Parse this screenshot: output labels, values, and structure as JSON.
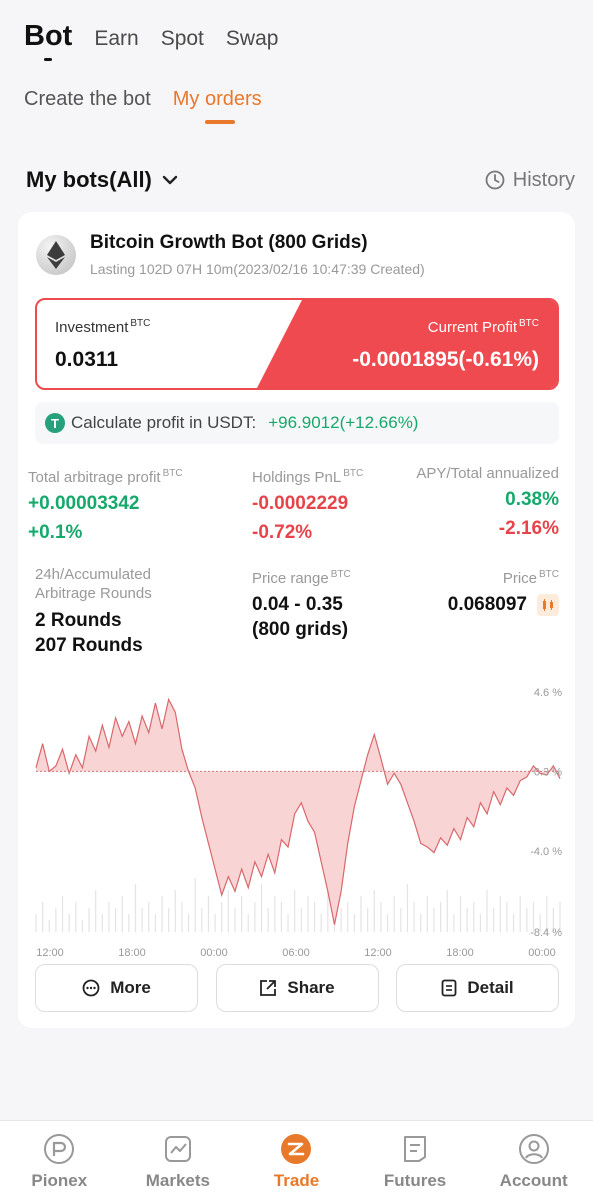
{
  "top_tabs": [
    "Bot",
    "Earn",
    "Spot",
    "Swap"
  ],
  "sub_tabs": [
    "Create the bot",
    "My orders"
  ],
  "bots_header": {
    "title": "My bots(All)",
    "history": "History"
  },
  "bot": {
    "name": "Bitcoin Growth Bot (800 Grids)",
    "lasting": "Lasting 102D 07H 10m(2023/02/16 10:47:39 Created)",
    "investment_label": "Investment",
    "investment_unit": "BTC",
    "investment_value": "0.0311",
    "profit_label": "Current Profit",
    "profit_unit": "BTC",
    "profit_value": "-0.0001895(-0.61%)",
    "usdt_label": "Calculate profit in USDT:",
    "usdt_value": "+96.9012(+12.66%)",
    "usdt_icon": "T"
  },
  "stats": {
    "arb_label": "Total arbitrage profit",
    "arb_unit": "BTC",
    "arb_v1": "+0.00003342",
    "arb_v2": "+0.1%",
    "hold_label": "Holdings PnL",
    "hold_unit": "BTC",
    "hold_v1": "-0.0002229",
    "hold_v2": "-0.72%",
    "apy_label": "APY/Total annualized",
    "apy_v1": "0.38%",
    "apy_v2": "-2.16%",
    "rounds_label": "24h/Accumulated Arbitrage Rounds",
    "rounds_v1": "2 Rounds",
    "rounds_v2": "207 Rounds",
    "range_label": "Price range",
    "range_unit": "BTC",
    "range_v1": "0.04 - 0.35",
    "range_v2": "(800 grids)",
    "price_label": "Price",
    "price_unit": "BTC",
    "price_value": "0.068097"
  },
  "chart_data": {
    "type": "area",
    "y_ticks": [
      "4.6 %",
      "0.3 %",
      "-4.0 %",
      "-8.4 %"
    ],
    "x_ticks": [
      "12:00",
      "18:00",
      "00:00",
      "06:00",
      "12:00",
      "18:00",
      "00:00"
    ],
    "ylim": [
      -8.4,
      4.6
    ],
    "baseline": 0.3,
    "values": [
      0.5,
      1.8,
      0.3,
      0.6,
      1.5,
      0.2,
      1.2,
      0.5,
      2.2,
      1.4,
      2.8,
      1.6,
      3.2,
      2.2,
      3.0,
      1.8,
      3.3,
      2.4,
      4.0,
      2.6,
      4.2,
      3.5,
      1.5,
      0.3,
      -0.6,
      -2.2,
      -3.6,
      -5.0,
      -6.4,
      -5.4,
      -6.2,
      -5.0,
      -6.0,
      -4.6,
      -5.4,
      -4.2,
      -5.2,
      -3.4,
      -3.8,
      -2.0,
      -1.4,
      -2.4,
      -3.0,
      -4.6,
      -6.2,
      -8.0,
      -6.2,
      -3.6,
      -1.6,
      -0.2,
      1.2,
      2.3,
      1.0,
      -0.4,
      0.2,
      -0.4,
      -1.4,
      -2.4,
      -3.6,
      -3.8,
      -4.1,
      -3.3,
      -3.7,
      -2.8,
      -3.4,
      -2.2,
      -2.7,
      -1.4,
      -2.0,
      -0.8,
      -1.5,
      -0.6,
      -1.0,
      -0.2,
      0.0,
      0.6,
      0.2,
      0.1,
      0.6,
      -0.1
    ],
    "volume": [
      0.3,
      0.5,
      0.2,
      0.4,
      0.6,
      0.3,
      0.5,
      0.2,
      0.4,
      0.7,
      0.3,
      0.5,
      0.4,
      0.6,
      0.3,
      0.8,
      0.4,
      0.5,
      0.3,
      0.6,
      0.4,
      0.7,
      0.5,
      0.3,
      0.9,
      0.4,
      0.6,
      0.3,
      0.5,
      0.7,
      0.4,
      0.6,
      0.3,
      0.5,
      0.8,
      0.4,
      0.6,
      0.5,
      0.3,
      0.7,
      0.4,
      0.6,
      0.5,
      0.3,
      0.9,
      0.6,
      0.4,
      0.5,
      0.3,
      0.6,
      0.4,
      0.7,
      0.5,
      0.3,
      0.6,
      0.4,
      0.8,
      0.5,
      0.3,
      0.6,
      0.4,
      0.5,
      0.7,
      0.3,
      0.6,
      0.4,
      0.5,
      0.3,
      0.7,
      0.4,
      0.6,
      0.5,
      0.3,
      0.6,
      0.4,
      0.5,
      0.3,
      0.6,
      0.4,
      0.5
    ]
  },
  "buttons": {
    "more": "More",
    "share": "Share",
    "detail": "Detail"
  },
  "nav": [
    "Pionex",
    "Markets",
    "Trade",
    "Futures",
    "Account"
  ],
  "colors": {
    "accent": "#e8792b",
    "loss": "#ef4a4f",
    "gain": "#17a86b"
  }
}
